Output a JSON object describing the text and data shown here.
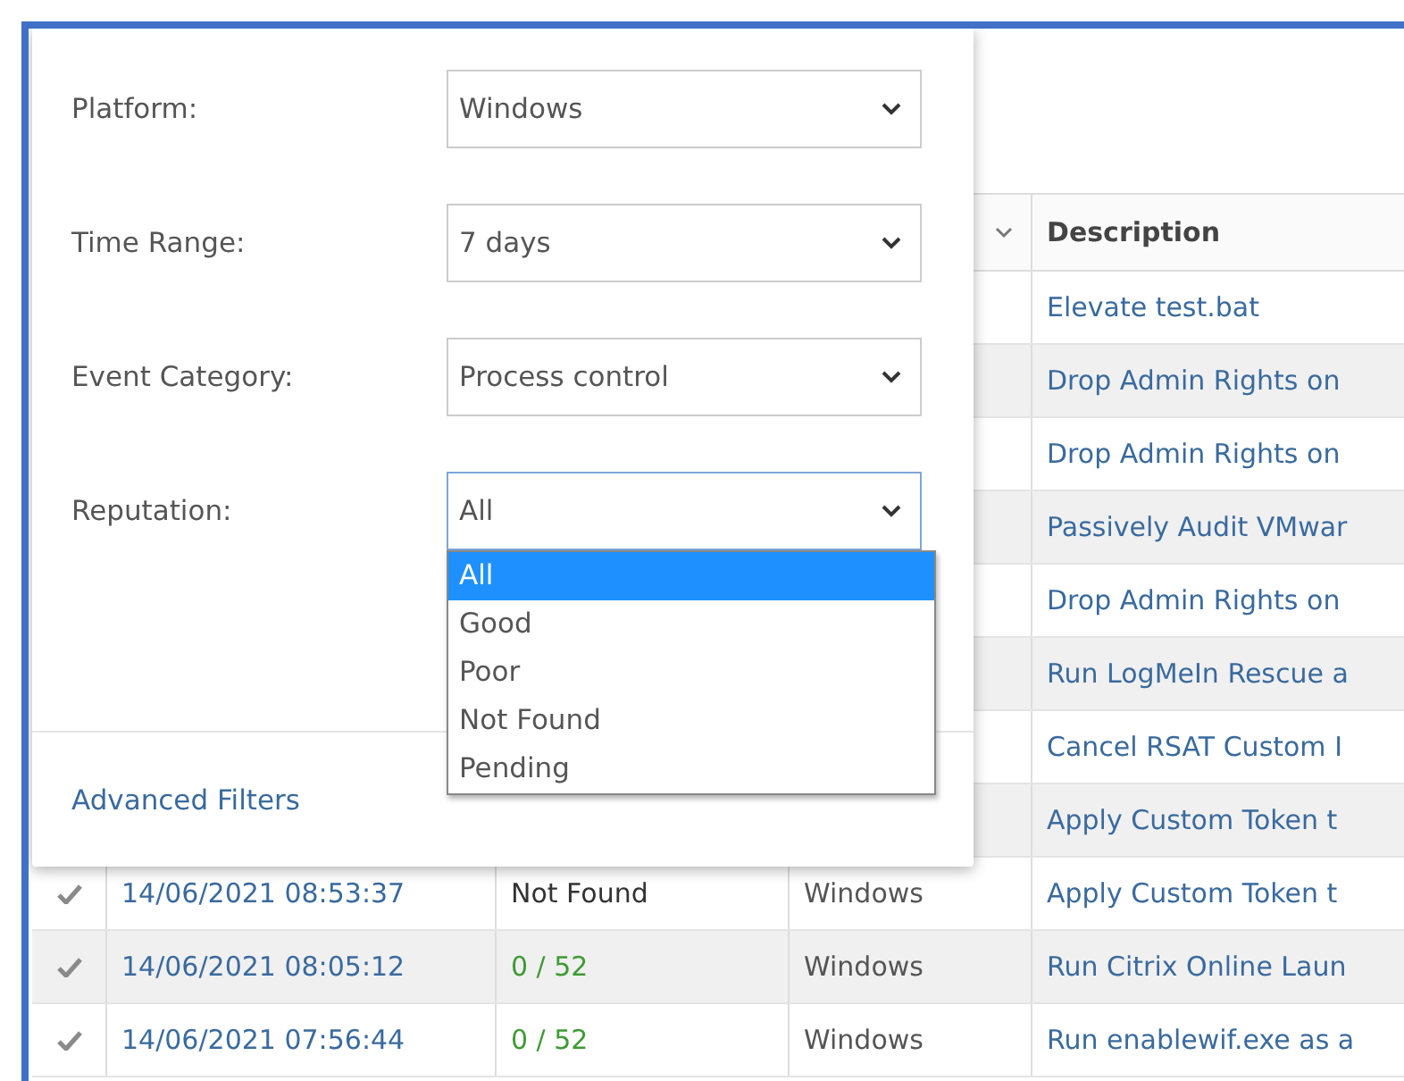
{
  "filters": [
    {
      "label": "Platform:",
      "value": "Windows",
      "open": false
    },
    {
      "label": "Time Range:",
      "value": "7 days",
      "open": false
    },
    {
      "label": "Event Category:",
      "value": "Process control",
      "open": false
    },
    {
      "label": "Reputation:",
      "value": "All",
      "open": true,
      "options": [
        {
          "label": "All",
          "selected": true
        },
        {
          "label": "Good",
          "selected": false
        },
        {
          "label": "Poor",
          "selected": false
        },
        {
          "label": "Not Found",
          "selected": false
        },
        {
          "label": "Pending",
          "selected": false
        }
      ]
    }
  ],
  "advanced_filters_link": "Advanced Filters",
  "table": {
    "columns": [
      {
        "label": "Description"
      }
    ],
    "rows": [
      {
        "description": "Elevate test.bat"
      },
      {
        "description": "Drop Admin Rights on"
      },
      {
        "description": "Drop Admin Rights on"
      },
      {
        "description": "Passively Audit VMwar"
      },
      {
        "description": "Drop Admin Rights on"
      },
      {
        "description": "Run LogMeIn Rescue a"
      },
      {
        "description": "Cancel RSAT Custom I"
      },
      {
        "description": "Apply Custom Token t"
      },
      {
        "date": "14/06/2021 08:53:37",
        "reputation": {
          "text": "Not Found",
          "color": "#333333"
        },
        "platform": "Windows",
        "description": "Apply Custom Token t"
      },
      {
        "date": "14/06/2021 08:05:12",
        "reputation": {
          "text": "0 / 52",
          "color": "#3f9a35"
        },
        "platform": "Windows",
        "description": "Run Citrix Online Laun"
      },
      {
        "date": "14/06/2021 07:56:44",
        "reputation": {
          "text": "0 / 52",
          "color": "#3f9a35"
        },
        "platform": "Windows",
        "description": "Run enablewif.exe as a"
      }
    ]
  }
}
